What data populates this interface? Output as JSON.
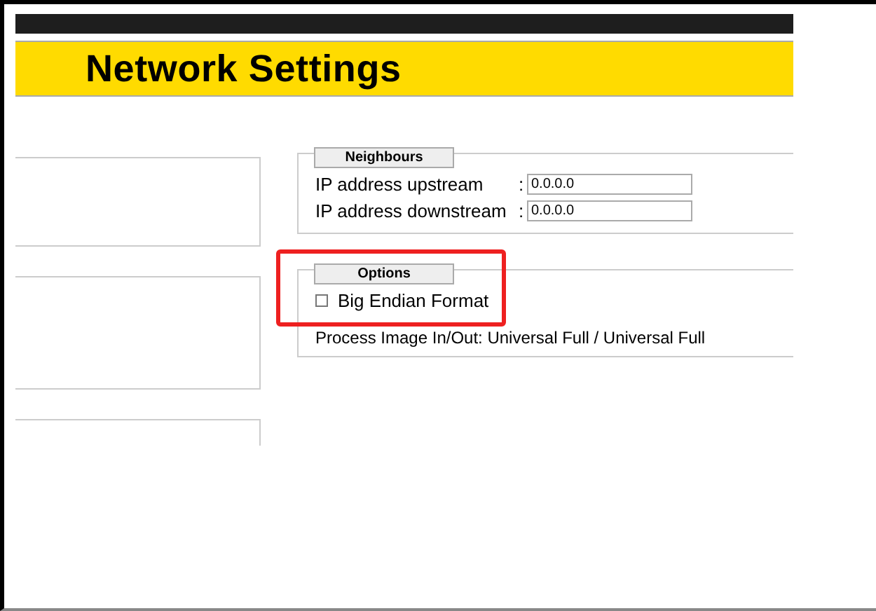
{
  "header": {
    "title": "Network Settings"
  },
  "neighbours": {
    "legend": "Neighbours",
    "fields": [
      {
        "label": "IP address upstream",
        "separator": ":",
        "value": "0.0.0.0"
      },
      {
        "label": "IP address downstream",
        "separator": ":",
        "value": "0.0.0.0"
      }
    ]
  },
  "options": {
    "legend": "Options",
    "highlighted": true,
    "checkboxes": [
      {
        "label": "Big Endian Format",
        "checked": false
      }
    ],
    "info": "Process Image In/Out: Universal Full / Universal Full"
  }
}
